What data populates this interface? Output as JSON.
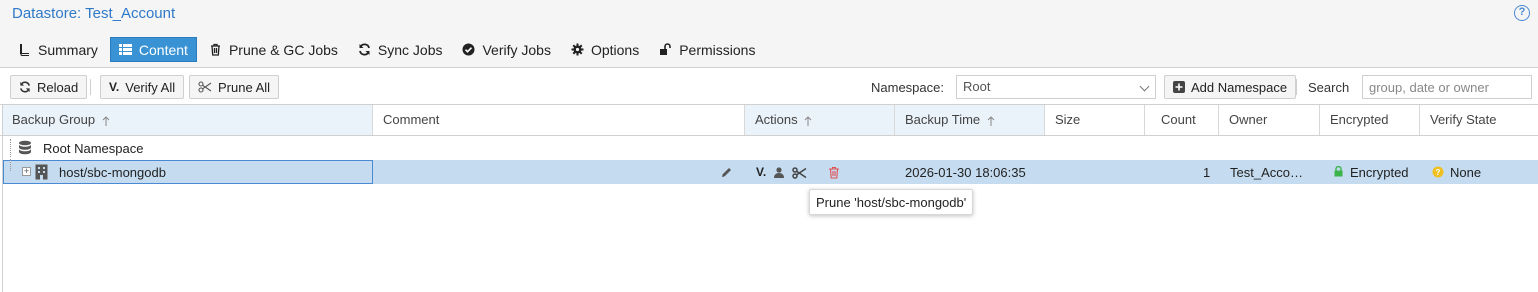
{
  "header": {
    "title": "Datastore: Test_Account",
    "help_icon": "help-icon"
  },
  "tabs": [
    {
      "label": "Summary",
      "icon": "book-icon",
      "active": false
    },
    {
      "label": "Content",
      "icon": "grid-icon",
      "active": true
    },
    {
      "label": "Prune & GC Jobs",
      "icon": "trash-icon",
      "active": false
    },
    {
      "label": "Sync Jobs",
      "icon": "refresh-icon",
      "active": false
    },
    {
      "label": "Verify Jobs",
      "icon": "check-circle-icon",
      "active": false
    },
    {
      "label": "Options",
      "icon": "gear-icon",
      "active": false
    },
    {
      "label": "Permissions",
      "icon": "unlock-icon",
      "active": false
    }
  ],
  "toolbar": {
    "reload_label": "Reload",
    "verify_all_label": "Verify All",
    "prune_all_label": "Prune All",
    "namespace_label": "Namespace:",
    "namespace_value": "Root",
    "add_namespace_label": "Add Namespace",
    "search_label": "Search",
    "search_placeholder": "group, date or owner"
  },
  "columns": {
    "backup_group": "Backup Group",
    "comment": "Comment",
    "actions": "Actions",
    "backup_time": "Backup Time",
    "size": "Size",
    "count": "Count",
    "owner": "Owner",
    "encrypted": "Encrypted",
    "verify_state": "Verify State"
  },
  "rows": {
    "namespace": {
      "label": "Root Namespace"
    },
    "host": {
      "group": "host/sbc-mongodb",
      "verify_glyph": "V.",
      "backup_time": "2026-01-30 18:06:35",
      "count": "1",
      "owner": "Test_Acco…",
      "encrypted": "Encrypted",
      "verify_state": "None"
    }
  },
  "tooltip": {
    "text": "Prune 'host/sbc-mongodb'"
  },
  "colors": {
    "accent": "#3892d4",
    "selected_row": "#c5dcf0",
    "title": "#2f79c9",
    "delete": "#e05050",
    "encrypted": "#3cb44b",
    "verify_none": "#f0c020"
  }
}
